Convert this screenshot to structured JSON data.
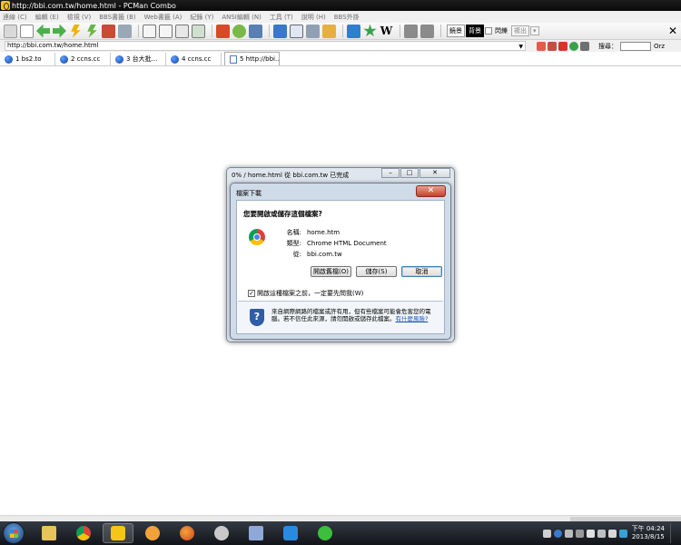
{
  "window": {
    "title": "http://bbi.com.tw/home.html - PCMan Combo"
  },
  "menu": [
    "連線 (C)",
    "編輯 (E)",
    "檢視 (V)",
    "BBS書籤 (B)",
    "Web書籤 (A)",
    "紀錄 (Y)",
    "ANSI編輯 (N)",
    "工具 (T)",
    "說明 (H)",
    "BBS外掛"
  ],
  "toolbar": {
    "ascii_label": "鏡景",
    "dark_label": "背景",
    "blink_label": "閃爍",
    "output_label": "複出"
  },
  "address": {
    "url": "http://bbi.com.tw/home.html",
    "search_label": "搜尋：",
    "search_engine": "Orz"
  },
  "tabs": [
    {
      "label": "1 bs2.to",
      "kind": "bbs"
    },
    {
      "label": "2 ccns.cc",
      "kind": "bbs"
    },
    {
      "label": "3 台大批...",
      "kind": "bbs"
    },
    {
      "label": "4 ccns.cc",
      "kind": "bbs"
    },
    {
      "label": "5 http://bbi...",
      "kind": "web"
    }
  ],
  "progress_window": {
    "title": "0% / home.html 從 bbi.com.tw 已完成"
  },
  "download_dialog": {
    "title": "檔案下載",
    "question": "您要開啟或儲存這個檔案?",
    "name_key": "名稱:",
    "name_val": "home.htm",
    "type_key": "類型:",
    "type_val": "Chrome HTML Document",
    "from_key": "從:",
    "from_val": "bbi.com.tw",
    "open_btn": "開啟舊檔(O)",
    "save_btn": "儲存(S)",
    "cancel_btn": "取消",
    "always_ask": "開啟這種檔案之前，一定要先問我(W)",
    "warning": "來自網際網路的檔案或許有用，但有些檔案可能會危害您的電腦。若不信任此來源，請勿開啟或儲存此檔案。",
    "warning_link": "有什麼風險?"
  },
  "taskbar": {
    "time": "下午 04:24",
    "date": "2013/8/15"
  },
  "colors": {
    "dialog_close": "#c4422c",
    "link": "#1a57b8"
  }
}
